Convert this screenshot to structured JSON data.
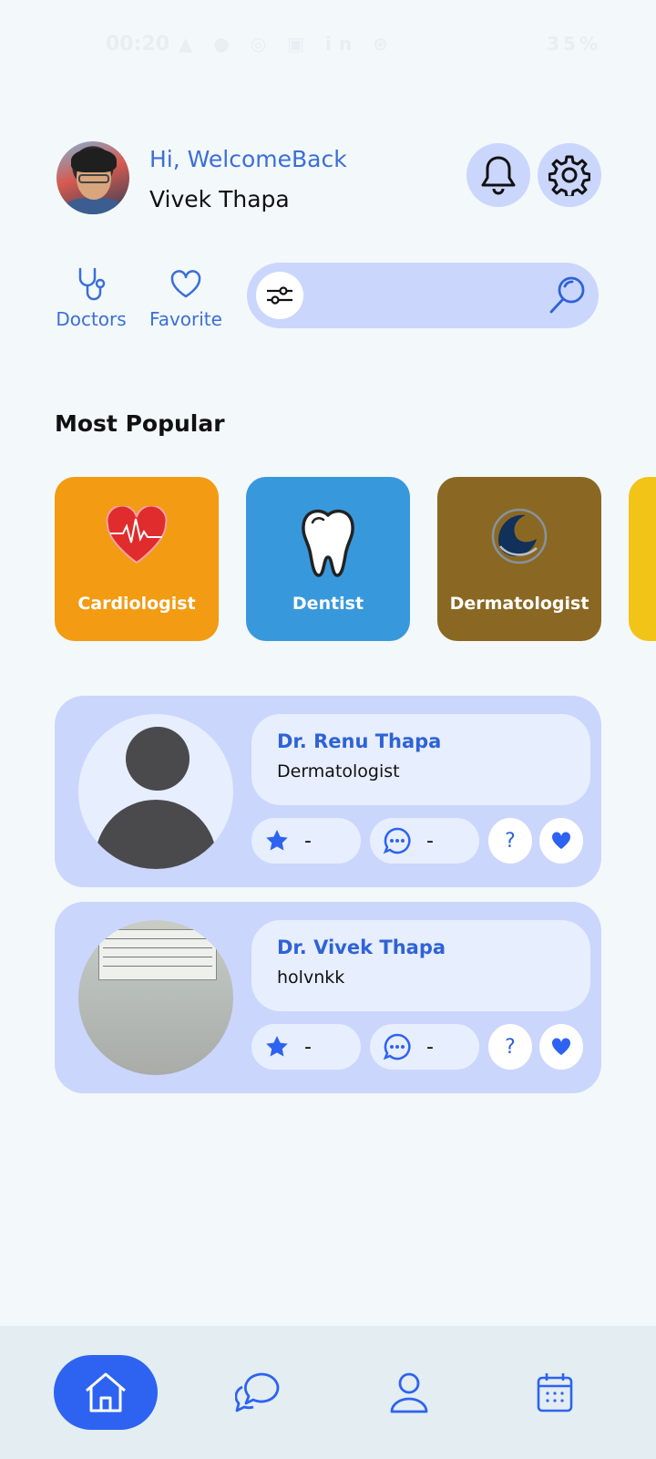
{
  "status_bar": {
    "time": "00:20",
    "left_icons": "▲ ● ◎ ▣ in ⊛",
    "battery": "35%"
  },
  "header": {
    "greeting": "Hi, WelcomeBack",
    "user_name": "Vivek Thapa"
  },
  "quick_links": {
    "doctors_label": "Doctors",
    "favorite_label": "Favorite"
  },
  "search": {
    "placeholder": ""
  },
  "popular": {
    "title": "Most Popular",
    "categories": [
      {
        "label": "Cardiologist",
        "color": "#f29b13"
      },
      {
        "label": "Dentist",
        "color": "#3898dc"
      },
      {
        "label": "Dermatologist",
        "color": "#8a6823"
      }
    ]
  },
  "doctors": [
    {
      "name": "Dr. Renu Thapa",
      "specialty": "Dermatologist",
      "rating": "-",
      "comments": "-",
      "help": "?"
    },
    {
      "name": "Dr. Vivek Thapa",
      "specialty": "holvnkk",
      "rating": "-",
      "comments": "-",
      "help": "?"
    }
  ],
  "colors": {
    "accent": "#2d63f0",
    "card_bg": "#cbd6fd",
    "page_bg": "#f3f8fb"
  },
  "bottom_nav": {
    "items": [
      "home-icon",
      "chat-icon",
      "profile-icon",
      "calendar-icon"
    ],
    "active": "home"
  }
}
